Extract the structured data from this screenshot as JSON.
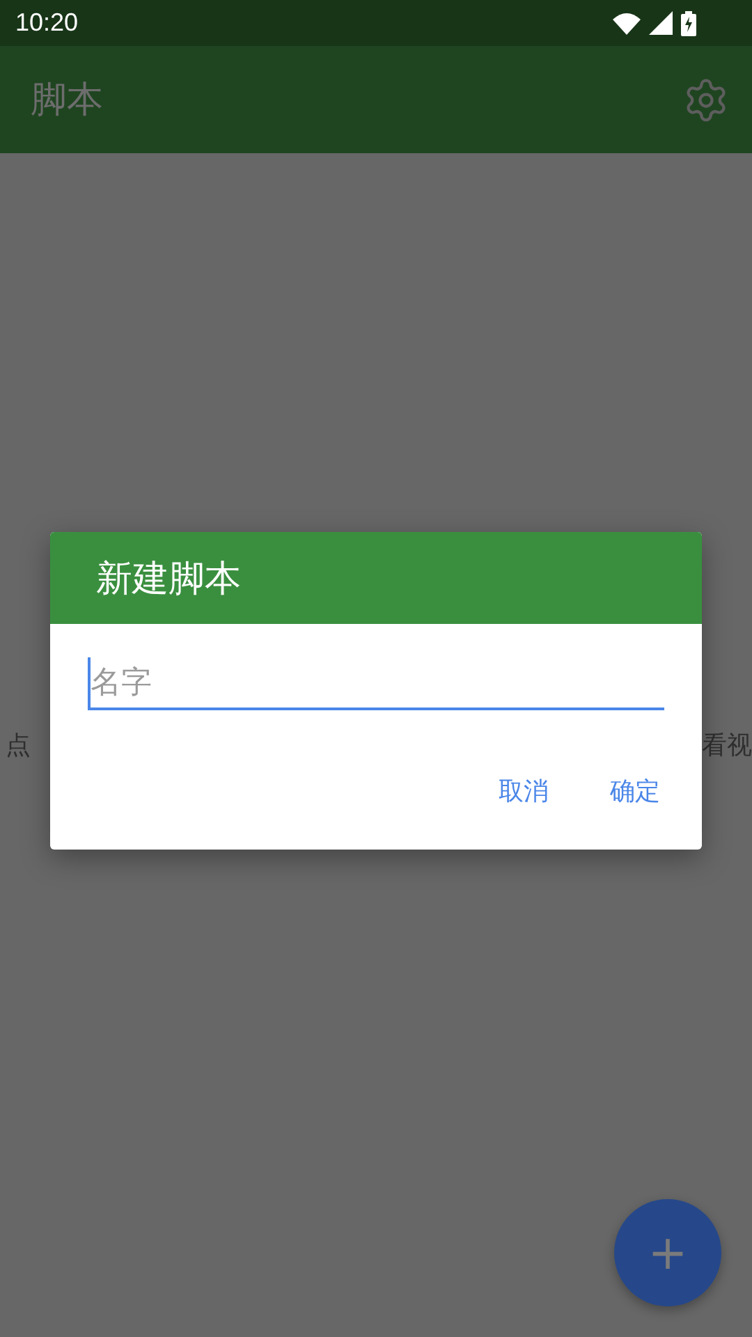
{
  "status_bar": {
    "time": "10:20"
  },
  "app_bar": {
    "title": "脚本"
  },
  "empty_hint": {
    "left_part": "点",
    "right_part": "看视"
  },
  "dialog": {
    "title": "新建脚本",
    "field": {
      "placeholder": "名字"
    },
    "buttons": [
      "取消",
      "确定"
    ]
  },
  "fab": {
    "label": "+"
  }
}
